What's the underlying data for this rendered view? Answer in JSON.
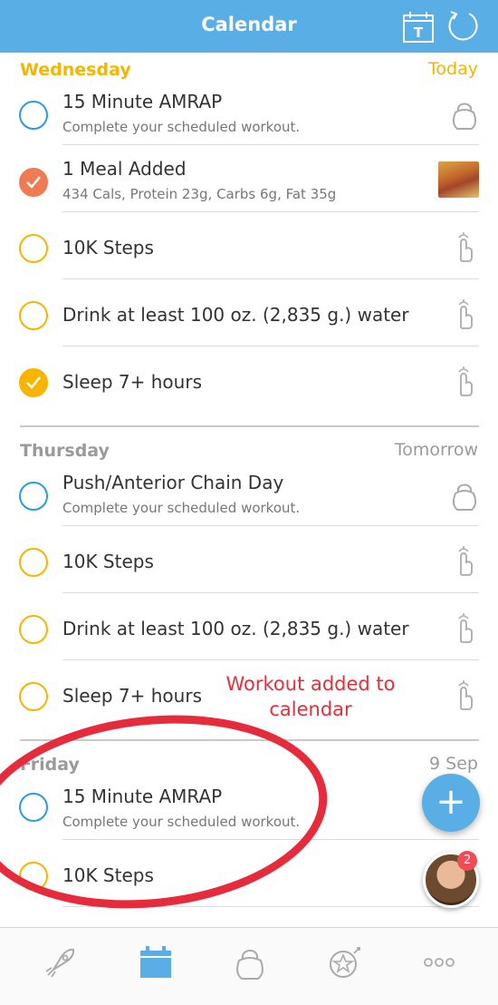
{
  "header": {
    "title": "Calendar",
    "calendar_icon_letter": "T"
  },
  "days": [
    {
      "name": "Wednesday",
      "when": "Today",
      "items": [
        {
          "title": "15 Minute AMRAP",
          "subtitle": "Complete your scheduled workout.",
          "status": "open",
          "icon": "kettlebell-icon"
        },
        {
          "title": "1 Meal Added",
          "subtitle": "434 Cals, Protein 23g, Carbs 6g, Fat 35g",
          "status": "done",
          "icon": "meal-thumbnail"
        },
        {
          "title": "10K Steps",
          "status": "open",
          "icon": "tap-finger-icon"
        },
        {
          "title": "Drink at least 100 oz. (2,835 g.) water",
          "status": "open",
          "icon": "tap-finger-icon"
        },
        {
          "title": "Sleep 7+ hours",
          "status": "done",
          "icon": "tap-finger-icon"
        }
      ]
    },
    {
      "name": "Thursday",
      "when": "Tomorrow",
      "items": [
        {
          "title": "Push/Anterior Chain Day",
          "subtitle": "Complete your scheduled workout.",
          "status": "open",
          "icon": "kettlebell-icon"
        },
        {
          "title": "10K Steps",
          "status": "open",
          "icon": "tap-finger-icon"
        },
        {
          "title": "Drink at least 100 oz. (2,835 g.) water",
          "status": "open",
          "icon": "tap-finger-icon"
        },
        {
          "title": "Sleep 7+ hours",
          "status": "open",
          "icon": "tap-finger-icon"
        }
      ]
    },
    {
      "name": "Friday",
      "when": "9 Sep",
      "items": [
        {
          "title": "15 Minute AMRAP",
          "subtitle": "Complete your scheduled workout.",
          "status": "open"
        },
        {
          "title": "10K Steps",
          "status": "open"
        }
      ]
    }
  ],
  "annotation": "Workout added to calendar",
  "fab_label": "+",
  "notification_count": "2",
  "tabs": [
    "rocket-icon",
    "calendar-icon",
    "kettlebell-icon",
    "achievements-icon",
    "more-icon"
  ],
  "colors": {
    "brand": "#5aaee6",
    "today": "#f7b500",
    "workout_check": "#2a9be0",
    "meal_done": "#f07a52",
    "annotation": "#e0313c"
  }
}
